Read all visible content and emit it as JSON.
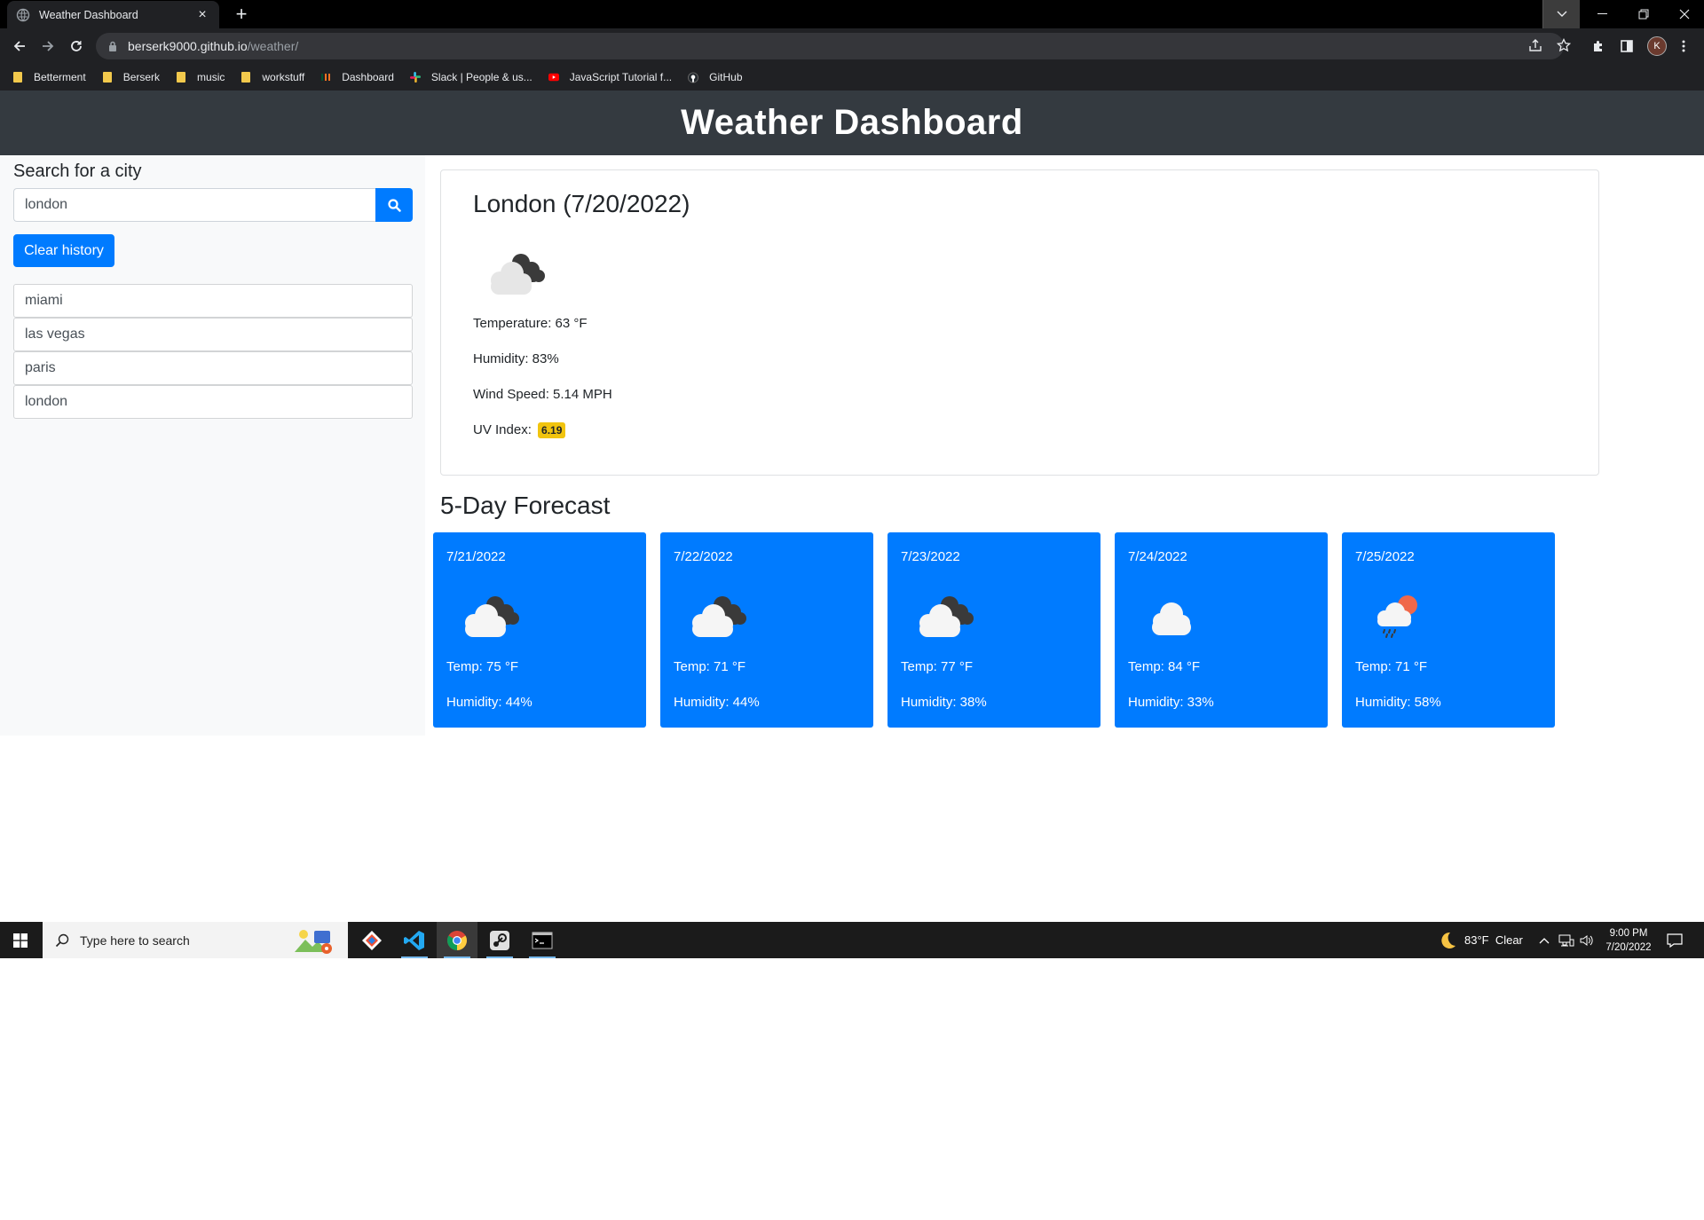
{
  "browser": {
    "tab_title": "Weather Dashboard",
    "tab_close": "×",
    "new_tab": "+",
    "url_host": "berserk9000.github.io",
    "url_path": "/weather/",
    "avatar_letter": "K",
    "bookmarks": [
      {
        "label": "Betterment",
        "icon": "folder-icon"
      },
      {
        "label": "Berserk",
        "icon": "folder-icon"
      },
      {
        "label": "music",
        "icon": "folder-icon"
      },
      {
        "label": "workstuff",
        "icon": "folder-icon"
      },
      {
        "label": "Dashboard",
        "icon": "dashboard-icon"
      },
      {
        "label": "Slack | People & us...",
        "icon": "slack-icon"
      },
      {
        "label": "JavaScript Tutorial f...",
        "icon": "youtube-icon"
      },
      {
        "label": "GitHub",
        "icon": "github-icon"
      }
    ]
  },
  "page": {
    "title": "Weather Dashboard",
    "sidebar": {
      "heading": "Search for a city",
      "search_value": "london",
      "clear_label": "Clear history",
      "history": [
        "miami",
        "las vegas",
        "paris",
        "london"
      ]
    },
    "current": {
      "heading": "London (7/20/2022)",
      "icon": "broken-clouds-icon",
      "temperature": "Temperature: 63 °F",
      "humidity": "Humidity: 83%",
      "wind": "Wind Speed: 5.14 MPH",
      "uv_label": "UV Index:",
      "uv_value": "6.19",
      "uv_color": "#f1c40f"
    },
    "forecast_heading": "5-Day Forecast",
    "forecast": [
      {
        "date": "7/21/2022",
        "icon": "broken-clouds-icon",
        "temp": "Temp: 75 °F",
        "humidity": "Humidity: 44%"
      },
      {
        "date": "7/22/2022",
        "icon": "broken-clouds-icon",
        "temp": "Temp: 71 °F",
        "humidity": "Humidity: 44%"
      },
      {
        "date": "7/23/2022",
        "icon": "broken-clouds-icon",
        "temp": "Temp: 77 °F",
        "humidity": "Humidity: 38%"
      },
      {
        "date": "7/24/2022",
        "icon": "cloud-icon",
        "temp": "Temp: 84 °F",
        "humidity": "Humidity: 33%"
      },
      {
        "date": "7/25/2022",
        "icon": "rain-sun-icon",
        "temp": "Temp: 71 °F",
        "humidity": "Humidity: 58%"
      }
    ],
    "accent_color": "#007bff",
    "header_color": "#343a40"
  },
  "taskbar": {
    "search_placeholder": "Type here to search",
    "weather": "83°F  Clear",
    "time": "9:00 PM",
    "date": "7/20/2022"
  }
}
